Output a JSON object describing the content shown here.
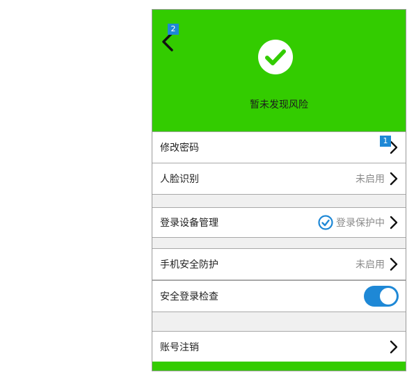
{
  "colors": {
    "header_bg": "#33cc00",
    "accent_blue": "#1e88d6",
    "section_gap": "#f0f0f0"
  },
  "header": {
    "back_icon": "chevron-left-icon",
    "back_badge": "2",
    "status_icon": "check-circle-icon",
    "status_text": "暂未发现风险"
  },
  "rows": {
    "change_password": {
      "label": "修改密码",
      "badge": "1"
    },
    "face_recognition": {
      "label": "人脸识别",
      "value": "未启用"
    },
    "device_management": {
      "label": "登录设备管理",
      "value": "登录保护中",
      "icon": "shield-check-icon"
    },
    "phone_protection": {
      "label": "手机安全防护",
      "value": "未启用"
    },
    "login_check": {
      "label": "安全登录检查",
      "toggle_on": true
    },
    "cancel_account": {
      "label": "账号注销"
    }
  }
}
